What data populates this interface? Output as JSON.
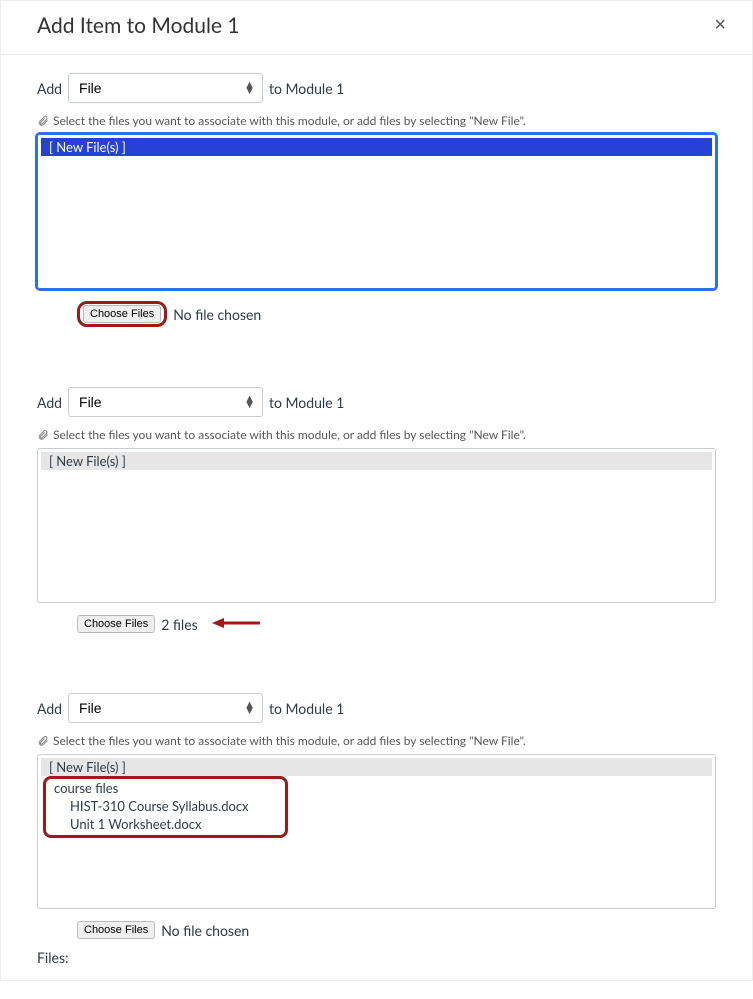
{
  "header": {
    "title": "Add Item to Module 1",
    "close": "×"
  },
  "common": {
    "add_label": "Add",
    "type_value": "File",
    "to_module_label": "to Module 1",
    "help_text": "Select the files you want to associate with this module, or add files by selecting \"New File\".",
    "new_file_option": "[ New File(s) ]",
    "choose_files_label": "Choose Files",
    "no_file_chosen": "No file chosen"
  },
  "section2": {
    "file_count_text": "2 files"
  },
  "section3": {
    "group_label": "course files",
    "file_a": "HIST-310 Course Syllabus.docx",
    "file_b": "Unit 1 Worksheet.docx",
    "files_label": "Files:"
  }
}
